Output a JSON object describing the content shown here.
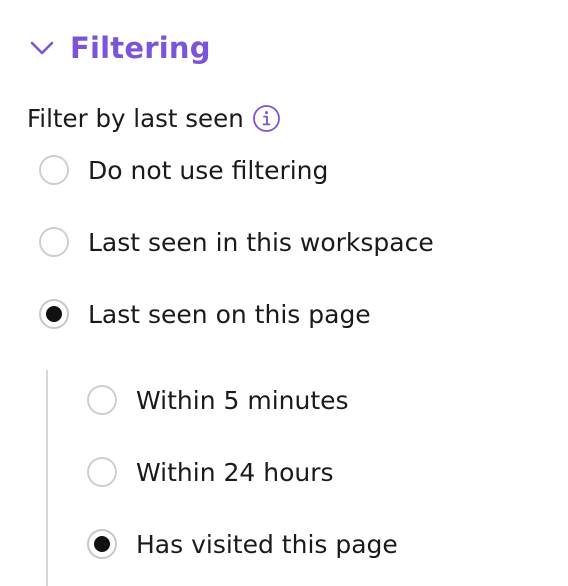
{
  "section": {
    "title": "Filtering",
    "expanded": true,
    "accent_color": "#7b54d8",
    "chevron_icon": "chevron-down-icon"
  },
  "filter": {
    "label": "Filter by last seen",
    "info_icon": "info-icon",
    "options": [
      {
        "label": "Do not use filtering",
        "checked": false
      },
      {
        "label": "Last seen in this workspace",
        "checked": false
      },
      {
        "label": "Last seen on this page",
        "checked": true
      }
    ],
    "sub_options": [
      {
        "label": "Within 5 minutes",
        "checked": false
      },
      {
        "label": "Within 24 hours",
        "checked": false
      },
      {
        "label": "Has visited this page",
        "checked": true
      }
    ]
  }
}
